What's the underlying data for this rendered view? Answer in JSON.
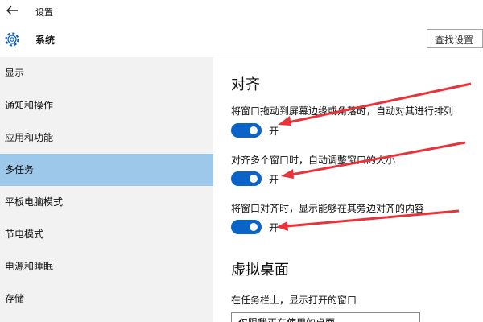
{
  "window": {
    "title": "设置"
  },
  "header": {
    "title": "系统",
    "search_label": "查找设置"
  },
  "sidebar": {
    "items": [
      {
        "label": "显示"
      },
      {
        "label": "通知和操作"
      },
      {
        "label": "应用和功能"
      },
      {
        "label": "多任务"
      },
      {
        "label": "平板电脑模式"
      },
      {
        "label": "节电模式"
      },
      {
        "label": "电源和睡眠"
      },
      {
        "label": "存储"
      }
    ],
    "active_label": "多任务"
  },
  "snap": {
    "heading": "对齐",
    "options": [
      {
        "description": "将窗口拖动到屏幕边缘或角落时，自动对其进行排列",
        "state": "开",
        "on": true
      },
      {
        "description": "对齐多个窗口时，自动调整窗口的大小",
        "state": "开",
        "on": true
      },
      {
        "description": "将窗口对齐时，显示能够在其旁边对齐的内容",
        "state": "开",
        "on": true
      }
    ]
  },
  "virtual_desktops": {
    "heading": "虚拟桌面",
    "taskbar_label": "在任务栏上，显示打开的窗口",
    "taskbar_value": "仅限我正在使用的桌面"
  },
  "icons": {
    "back": "back-arrow-icon",
    "system": "gear-icon",
    "dropdown": "chevron-down-icon",
    "annotation": "red-arrow-icon"
  },
  "colors": {
    "toggle_on": "#0a64c8",
    "sidebar_active": "#9ec8ea",
    "sidebar_bg": "#f2f2f2",
    "annotation_arrow": "#e8333a"
  }
}
